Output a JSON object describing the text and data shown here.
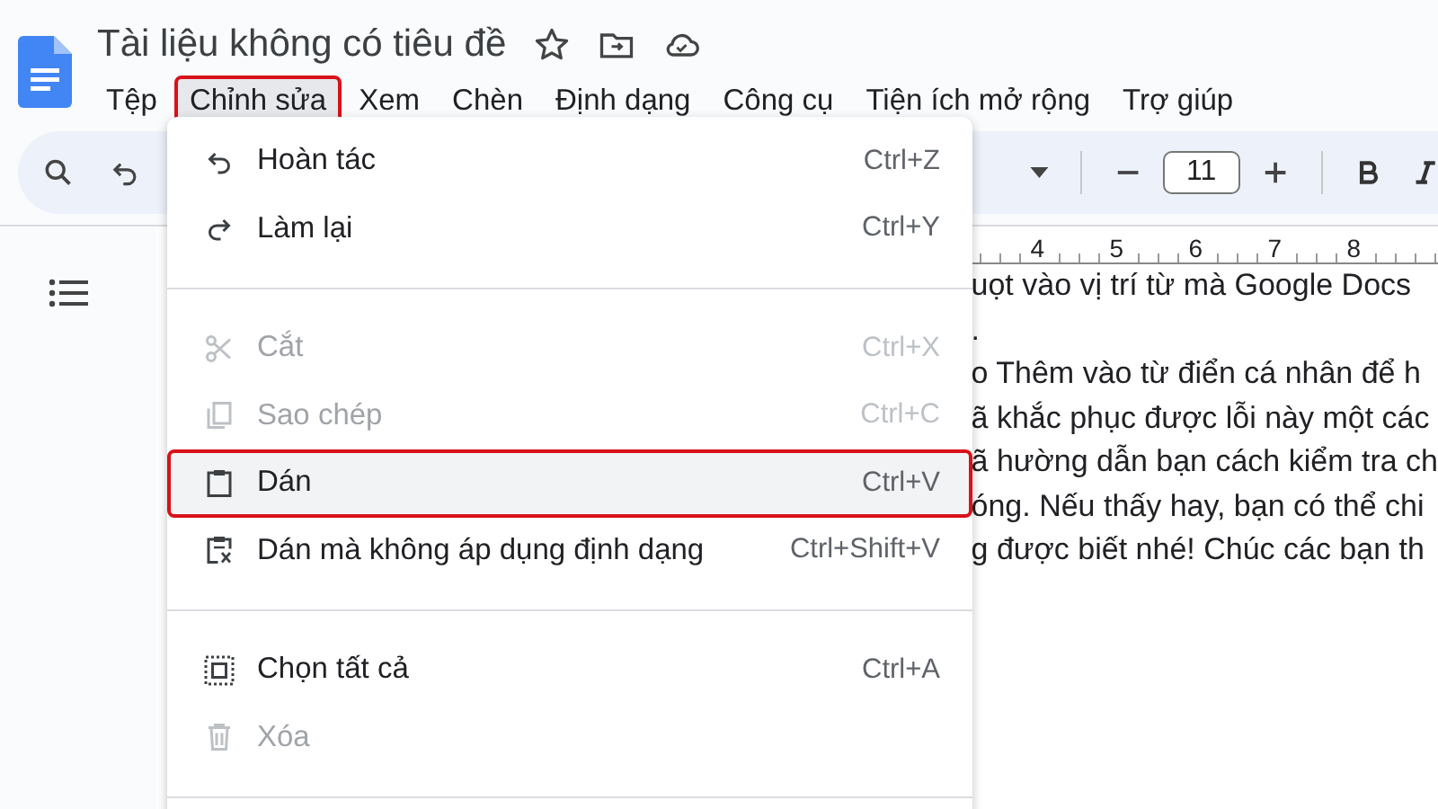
{
  "title": "Tài liệu không có tiêu đề",
  "menubar": [
    {
      "label": "Tệp",
      "selected": false,
      "highlighted": false
    },
    {
      "label": "Chỉnh sửa",
      "selected": true,
      "highlighted": true
    },
    {
      "label": "Xem",
      "selected": false,
      "highlighted": false
    },
    {
      "label": "Chèn",
      "selected": false,
      "highlighted": false
    },
    {
      "label": "Định dạng",
      "selected": false,
      "highlighted": false
    },
    {
      "label": "Công cụ",
      "selected": false,
      "highlighted": false
    },
    {
      "label": "Tiện ích mở rộng",
      "selected": false,
      "highlighted": false
    },
    {
      "label": "Trợ giúp",
      "selected": false,
      "highlighted": false
    }
  ],
  "toolbar": {
    "font_size": "11"
  },
  "ruler": [
    "4",
    "5",
    "6",
    "7",
    "8"
  ],
  "document_lines": [
    "uọt vào vị trí từ mà Google Docs",
    ".",
    "o Thêm vào từ điển cá nhân để h",
    "ã khắc phục được lỗi này một các",
    "ã hường dẫn bạn cách kiểm tra ch",
    "óng. Nếu thấy hay, bạn có thể chi",
    "g được biết nhé! Chúc các bạn th"
  ],
  "edit_menu": [
    {
      "kind": "item",
      "label": "Hoàn tác",
      "shortcut": "Ctrl+Z",
      "disabled": false,
      "selected": false,
      "highlighted": false
    },
    {
      "kind": "item",
      "label": "Làm lại",
      "shortcut": "Ctrl+Y",
      "disabled": false,
      "selected": false,
      "highlighted": false
    },
    {
      "kind": "divider"
    },
    {
      "kind": "item",
      "label": "Cắt",
      "shortcut": "Ctrl+X",
      "disabled": true,
      "selected": false,
      "highlighted": false
    },
    {
      "kind": "item",
      "label": "Sao chép",
      "shortcut": "Ctrl+C",
      "disabled": true,
      "selected": false,
      "highlighted": false
    },
    {
      "kind": "item",
      "label": "Dán",
      "shortcut": "Ctrl+V",
      "disabled": false,
      "selected": true,
      "highlighted": true
    },
    {
      "kind": "item",
      "label": "Dán mà không áp dụng định dạng",
      "shortcut": "Ctrl+Shift+V",
      "disabled": false,
      "selected": false,
      "highlighted": false
    },
    {
      "kind": "divider"
    },
    {
      "kind": "item",
      "label": "Chọn tất cả",
      "shortcut": "Ctrl+A",
      "disabled": false,
      "selected": false,
      "highlighted": false
    },
    {
      "kind": "item",
      "label": "Xóa",
      "disabled": true,
      "selected": false,
      "highlighted": false
    },
    {
      "kind": "divider"
    }
  ]
}
